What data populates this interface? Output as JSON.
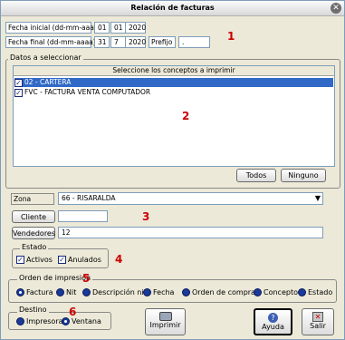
{
  "window": {
    "title": "Relación de facturas",
    "close_glyph": "✕"
  },
  "section1": {
    "fecha_inicial": {
      "label": "Fecha inicial (dd-mm-aaaa)",
      "day": "01",
      "month": "01",
      "year": "2020"
    },
    "fecha_final": {
      "label": "Fecha final (dd-mm-aaaa)",
      "day": "31",
      "month": "7",
      "year": "2020"
    },
    "prefijo": {
      "label": "Prefijo",
      "value": "."
    },
    "marker": "1"
  },
  "datos": {
    "group_title": "Datos a seleccionar",
    "list_header": "Seleccione los conceptos a imprimir",
    "items": [
      {
        "label": "02 - CARTERA",
        "checked": true,
        "selected": true
      },
      {
        "label": "FVC - FACTURA VENTA COMPUTADOR",
        "checked": true,
        "selected": false
      }
    ],
    "marker": "2",
    "todos_label": "Todos",
    "ninguno_label": "Ninguno"
  },
  "filtros": {
    "zona_label": "Zona",
    "zona_value": "66 - RISARALDA",
    "cliente_label": "Cliente",
    "cliente_value": "",
    "vendedores_label": "Vendedores",
    "vendedores_value": "12",
    "marker": "3"
  },
  "estado": {
    "title": "Estado",
    "activos_label": "Activos",
    "anulados_label": "Anulados",
    "marker": "4"
  },
  "orden": {
    "title": "Orden de impresión",
    "marker": "5",
    "options": [
      "Factura",
      "Nit",
      "Descripción nit",
      "Fecha",
      "Orden de compra",
      "Concepto",
      "Estado"
    ],
    "selected": "Factura"
  },
  "destino": {
    "title": "Destino",
    "marker": "6",
    "impresora_label": "Impresora",
    "ventana_label": "Ventana",
    "selected": "Ventana"
  },
  "actions": {
    "imprimir_label": "Imprimir",
    "ayuda_label": "Ayuda",
    "salir_label": "Salir"
  },
  "colors": {
    "accent_blue": "#1a3a9a",
    "marker_red": "#cc0000",
    "list_selection": "#3169c6"
  }
}
